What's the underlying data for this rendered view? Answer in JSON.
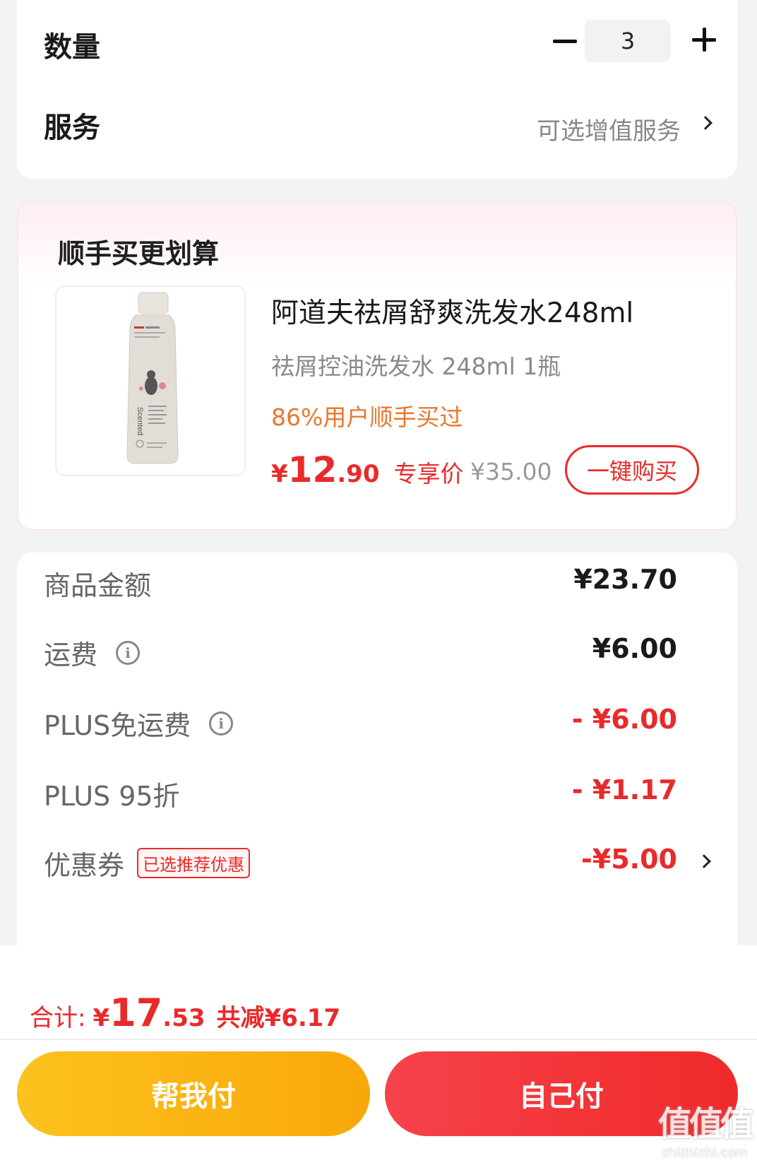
{
  "quantity": {
    "label": "数量",
    "value": "3"
  },
  "service": {
    "label": "服务",
    "value": "可选增值服务"
  },
  "addon": {
    "title": "顺手买更划算",
    "product": {
      "name": "阿道夫祛屑舒爽洗发水248ml",
      "spec": "祛屑控油洗发水 248ml 1瓶",
      "stat": "86%用户顺手买过",
      "price_symbol": "¥",
      "price_int": "12",
      "price_dec": ".90",
      "price_tag": "专享价",
      "original_price": "¥35.00",
      "buy_label": "一键购买",
      "bottle_text": "Scented"
    }
  },
  "price_details": [
    {
      "label": "商品金额",
      "value": "¥23.70"
    },
    {
      "label": "运费",
      "value": "¥6.00"
    },
    {
      "label": "PLUS免运费",
      "value": "- ¥6.00"
    },
    {
      "label": "PLUS 95折",
      "value": "- ¥1.17"
    },
    {
      "label": "优惠券",
      "badge": "已选推荐优惠",
      "value": "-¥5.00"
    }
  ],
  "total": {
    "label": "合计:",
    "symbol": "¥",
    "int": "17",
    "dec": ".53",
    "saved": "共减¥6.17"
  },
  "buttons": {
    "help_pay": "帮我付",
    "self_pay": "自己付"
  },
  "watermark": {
    "mark": "值值值",
    "url": "zhizhizhi.com"
  },
  "colors": {
    "accent_red": "#e92a2a",
    "accent_orange": "#e8772e",
    "help_pay_yellow": "#fcc21d"
  }
}
